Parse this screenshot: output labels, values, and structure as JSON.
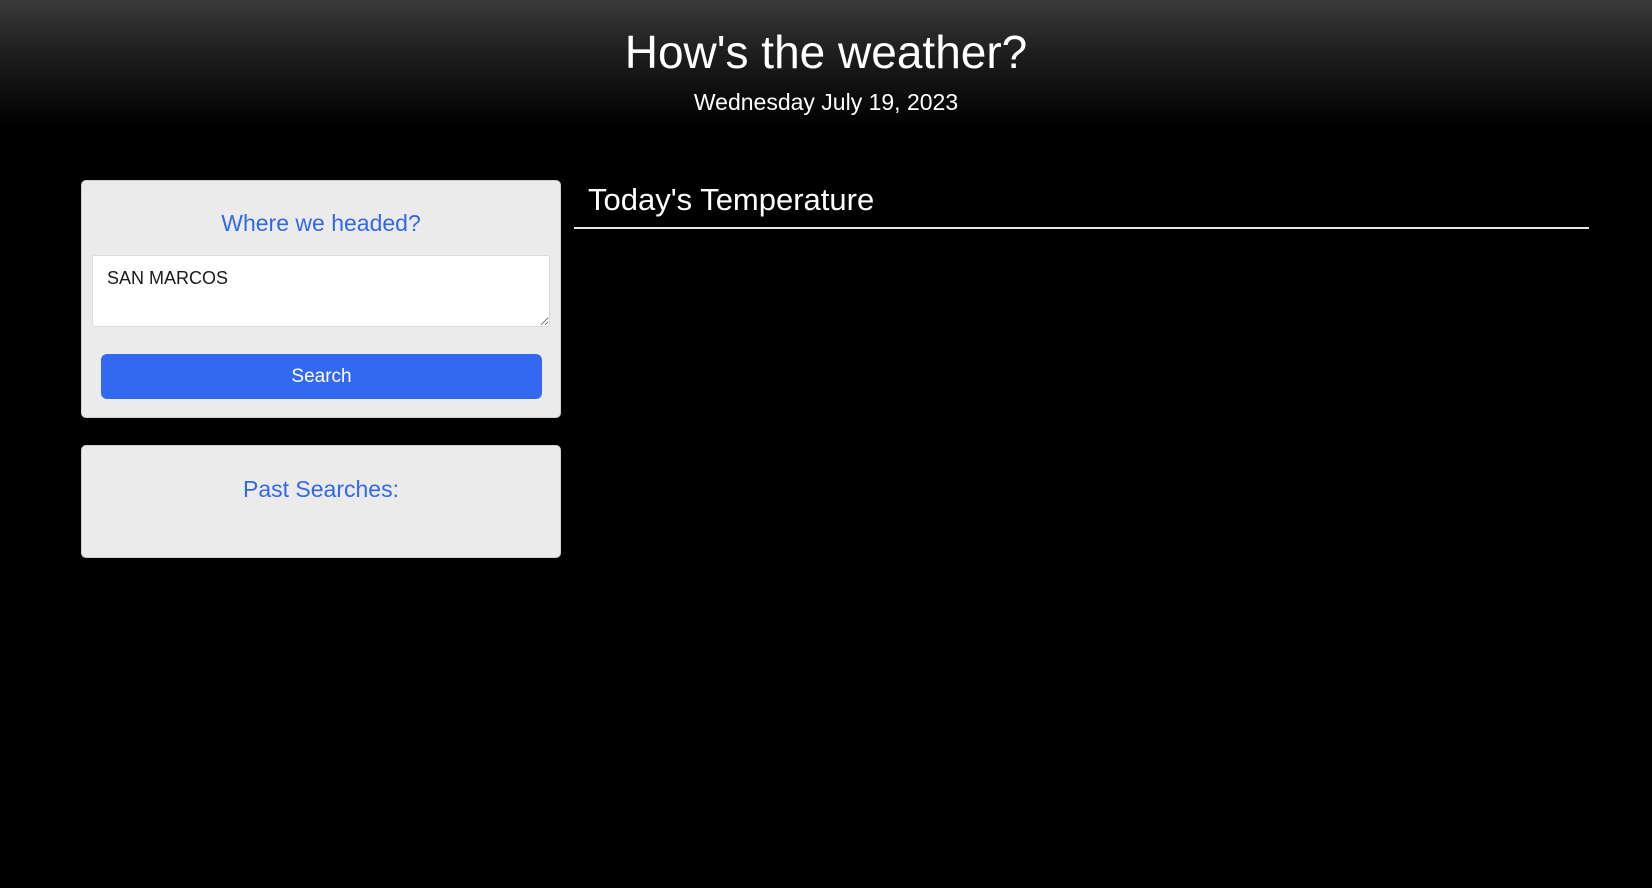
{
  "header": {
    "title": "How's the weather?",
    "date": "Wednesday July 19, 2023"
  },
  "search": {
    "heading": "Where we headed?",
    "input_value": "SAN MARCOS",
    "button_label": "Search"
  },
  "history": {
    "heading": "Past Searches:",
    "items": []
  },
  "results": {
    "title": "Today's Temperature"
  },
  "colors": {
    "accent": "#3369f0",
    "heading_blue": "#3169ea",
    "card_bg": "#ebebeb",
    "page_bg": "#000000"
  }
}
